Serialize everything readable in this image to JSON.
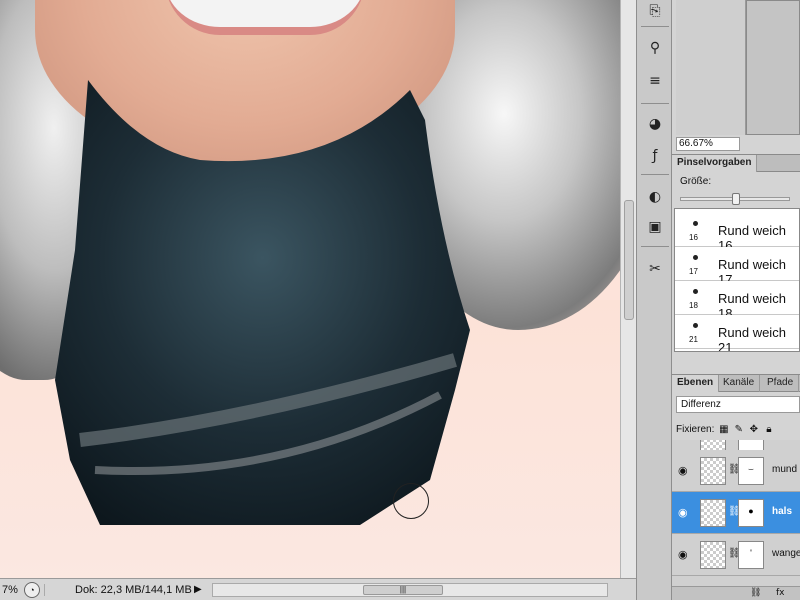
{
  "canvas": {
    "layer_blend_preview": "Differenz"
  },
  "status_bar": {
    "zoom": "7%",
    "doc_info": "Dok: 22,3 MB/144,1 MB"
  },
  "tools": [
    {
      "icon": "clone-source-icon"
    },
    {
      "icon": "brush-icon"
    },
    {
      "icon": "stamp-icon"
    },
    {
      "icon": "palette-icon"
    },
    {
      "icon": "fx-icon"
    },
    {
      "icon": "adjustment-icon"
    },
    {
      "icon": "mask-icon"
    },
    {
      "icon": "tools-icon"
    }
  ],
  "navigator": {
    "zoom": "66.67%"
  },
  "brush_panel": {
    "tab": "Pinselvorgaben",
    "size_label": "Größe:",
    "size_level": 0.5,
    "presets": [
      {
        "num": "16",
        "name": "Rund weich 16"
      },
      {
        "num": "17",
        "name": "Rund weich 17"
      },
      {
        "num": "18",
        "name": "Rund weich 18"
      },
      {
        "num": "21",
        "name": "Rund weich 21"
      }
    ]
  },
  "layers_panel": {
    "tabs": [
      "Ebenen",
      "Kanäle",
      "Pfade"
    ],
    "blend_mode": "Differenz",
    "lock_label": "Fixieren:",
    "layers": [
      {
        "name": "mund",
        "selected": false,
        "mask_mark": "⌣"
      },
      {
        "name": "hals",
        "selected": true,
        "mask_mark": "●"
      },
      {
        "name": "wange",
        "selected": false,
        "mask_mark": "'"
      }
    ],
    "footer_fx": "fx"
  },
  "colors": {
    "selection": "#3b8fe0",
    "panel_bg": "#d4d4d4",
    "skin_bg": "#fde3da"
  }
}
